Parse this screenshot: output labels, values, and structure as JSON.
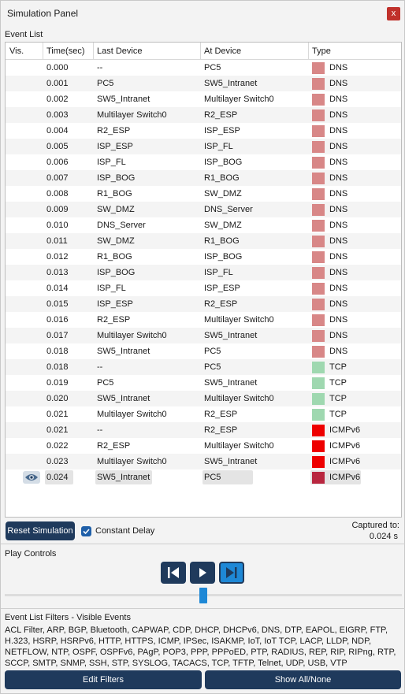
{
  "window": {
    "title": "Simulation Panel",
    "close_glyph": "x"
  },
  "event_list": {
    "label": "Event List",
    "columns": {
      "vis": "Vis.",
      "time": "Time(sec)",
      "last": "Last Device",
      "at": "At Device",
      "type": "Type"
    },
    "events": [
      {
        "time": "0.000",
        "last": "--",
        "at": "PC5",
        "type": "DNS",
        "color": "#d88787"
      },
      {
        "time": "0.001",
        "last": "PC5",
        "at": "SW5_Intranet",
        "type": "DNS",
        "color": "#d88787"
      },
      {
        "time": "0.002",
        "last": "SW5_Intranet",
        "at": "Multilayer Switch0",
        "type": "DNS",
        "color": "#d88787"
      },
      {
        "time": "0.003",
        "last": "Multilayer Switch0",
        "at": "R2_ESP",
        "type": "DNS",
        "color": "#d88787"
      },
      {
        "time": "0.004",
        "last": "R2_ESP",
        "at": "ISP_ESP",
        "type": "DNS",
        "color": "#d88787"
      },
      {
        "time": "0.005",
        "last": "ISP_ESP",
        "at": "ISP_FL",
        "type": "DNS",
        "color": "#d88787"
      },
      {
        "time": "0.006",
        "last": "ISP_FL",
        "at": "ISP_BOG",
        "type": "DNS",
        "color": "#d88787"
      },
      {
        "time": "0.007",
        "last": "ISP_BOG",
        "at": "R1_BOG",
        "type": "DNS",
        "color": "#d88787"
      },
      {
        "time": "0.008",
        "last": "R1_BOG",
        "at": "SW_DMZ",
        "type": "DNS",
        "color": "#d88787"
      },
      {
        "time": "0.009",
        "last": "SW_DMZ",
        "at": "DNS_Server",
        "type": "DNS",
        "color": "#d88787"
      },
      {
        "time": "0.010",
        "last": "DNS_Server",
        "at": "SW_DMZ",
        "type": "DNS",
        "color": "#d88787"
      },
      {
        "time": "0.011",
        "last": "SW_DMZ",
        "at": "R1_BOG",
        "type": "DNS",
        "color": "#d88787"
      },
      {
        "time": "0.012",
        "last": "R1_BOG",
        "at": "ISP_BOG",
        "type": "DNS",
        "color": "#d88787"
      },
      {
        "time": "0.013",
        "last": "ISP_BOG",
        "at": "ISP_FL",
        "type": "DNS",
        "color": "#d88787"
      },
      {
        "time": "0.014",
        "last": "ISP_FL",
        "at": "ISP_ESP",
        "type": "DNS",
        "color": "#d88787"
      },
      {
        "time": "0.015",
        "last": "ISP_ESP",
        "at": "R2_ESP",
        "type": "DNS",
        "color": "#d88787"
      },
      {
        "time": "0.016",
        "last": "R2_ESP",
        "at": "Multilayer Switch0",
        "type": "DNS",
        "color": "#d88787"
      },
      {
        "time": "0.017",
        "last": "Multilayer Switch0",
        "at": "SW5_Intranet",
        "type": "DNS",
        "color": "#d88787"
      },
      {
        "time": "0.018",
        "last": "SW5_Intranet",
        "at": "PC5",
        "type": "DNS",
        "color": "#d88787"
      },
      {
        "time": "0.018",
        "last": "--",
        "at": "PC5",
        "type": "TCP",
        "color": "#9fd8b0"
      },
      {
        "time": "0.019",
        "last": "PC5",
        "at": "SW5_Intranet",
        "type": "TCP",
        "color": "#9fd8b0"
      },
      {
        "time": "0.020",
        "last": "SW5_Intranet",
        "at": "Multilayer Switch0",
        "type": "TCP",
        "color": "#9fd8b0"
      },
      {
        "time": "0.021",
        "last": "Multilayer Switch0",
        "at": "R2_ESP",
        "type": "TCP",
        "color": "#9fd8b0"
      },
      {
        "time": "0.021",
        "last": "--",
        "at": "R2_ESP",
        "type": "ICMPv6",
        "color": "#ee0000"
      },
      {
        "time": "0.022",
        "last": "R2_ESP",
        "at": "Multilayer Switch0",
        "type": "ICMPv6",
        "color": "#ee0000"
      },
      {
        "time": "0.023",
        "last": "Multilayer Switch0",
        "at": "SW5_Intranet",
        "type": "ICMPv6",
        "color": "#ee0000"
      },
      {
        "time": "0.024",
        "last": "SW5_Intranet",
        "at": "PC5",
        "type": "ICMPv6",
        "color": "#b8263f",
        "selected": true,
        "visible_icon": "eye-icon"
      }
    ]
  },
  "controls": {
    "reset_label": "Reset Simulation",
    "constant_delay_label": "Constant Delay",
    "constant_delay_checked": true,
    "captured_label": "Captured to:",
    "captured_value": "0.024 s"
  },
  "play_controls": {
    "label": "Play Controls",
    "buttons": [
      "back-icon",
      "play-icon",
      "capture-forward-icon"
    ],
    "progress": 0.5
  },
  "filters": {
    "label": "Event List Filters - Visible Events",
    "list": "ACL Filter, ARP, BGP, Bluetooth, CAPWAP, CDP, DHCP, DHCPv6, DNS, DTP, EAPOL, EIGRP, FTP, H.323, HSRP, HSRPv6, HTTP, HTTPS, ICMP, IPSec, ISAKMP, IoT, IoT TCP, LACP, LLDP, NDP, NETFLOW, NTP, OSPF, OSPFv6, PAgP, POP3, PPP, PPPoED, PTP, RADIUS, REP, RIP, RIPng, RTP, SCCP, SMTP, SNMP, SSH, STP, SYSLOG, TACACS, TCP, TFTP, Telnet, UDP, USB, VTP",
    "edit_label": "Edit Filters",
    "show_label": "Show All/None"
  }
}
